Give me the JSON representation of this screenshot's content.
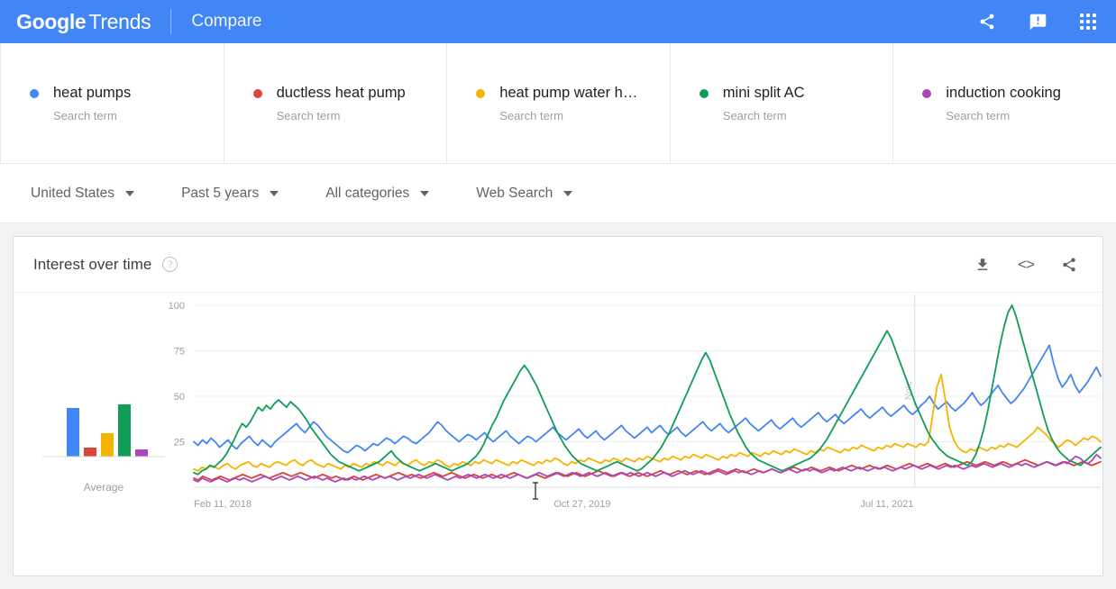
{
  "header": {
    "logo_google": "Google",
    "logo_trends": "Trends",
    "page_label": "Compare",
    "icons": {
      "share": "share-icon",
      "feedback": "feedback-icon",
      "apps": "apps-grid-icon"
    }
  },
  "terms": [
    {
      "label": "heat pumps",
      "subtitle": "Search term",
      "color": "#4285f4"
    },
    {
      "label": "ductless heat pump",
      "subtitle": "Search term",
      "color": "#db4437"
    },
    {
      "label": "heat pump water h…",
      "subtitle": "Search term",
      "color": "#f4b400"
    },
    {
      "label": "mini split AC",
      "subtitle": "Search term",
      "color": "#0f9d58"
    },
    {
      "label": "induction cooking",
      "subtitle": "Search term",
      "color": "#ab47bc"
    }
  ],
  "filters": [
    {
      "label": "United States"
    },
    {
      "label": "Past 5 years"
    },
    {
      "label": "All categories"
    },
    {
      "label": "Web Search"
    }
  ],
  "card": {
    "title": "Interest over time",
    "help": "?",
    "tools": {
      "download": "download-icon",
      "embed": "<>",
      "share": "share-icon"
    }
  },
  "chart_data": {
    "type": "line",
    "title": "Interest over time",
    "xlabel": "",
    "ylabel": "",
    "ylim": [
      0,
      100
    ],
    "yticks": [
      25,
      50,
      75,
      100
    ],
    "xticks": [
      "Feb 11, 2018",
      "Oct 27, 2019",
      "Jul 11, 2021"
    ],
    "xtick_positions": [
      0.0,
      0.397,
      0.735
    ],
    "grid": true,
    "legend": "top",
    "annotation": {
      "label": "Note",
      "x_fraction": 0.795
    },
    "average": {
      "label": "Average",
      "values": [
        27,
        5,
        13,
        29,
        4
      ]
    },
    "series": [
      {
        "name": "heat pumps",
        "color": "#4285f4",
        "values": [
          25,
          23,
          26,
          24,
          27,
          25,
          22,
          24,
          26,
          23,
          21,
          24,
          26,
          28,
          25,
          23,
          26,
          24,
          22,
          25,
          27,
          29,
          31,
          33,
          35,
          32,
          30,
          33,
          36,
          34,
          31,
          28,
          26,
          24,
          22,
          20,
          19,
          21,
          23,
          22,
          20,
          22,
          24,
          23,
          25,
          27,
          26,
          24,
          26,
          28,
          27,
          25,
          24,
          26,
          28,
          30,
          33,
          36,
          34,
          31,
          29,
          27,
          25,
          27,
          29,
          28,
          26,
          28,
          30,
          27,
          25,
          27,
          29,
          31,
          28,
          26,
          24,
          26,
          28,
          27,
          25,
          27,
          29,
          31,
          33,
          30,
          28,
          26,
          28,
          30,
          32,
          29,
          27,
          29,
          31,
          28,
          26,
          28,
          30,
          32,
          34,
          31,
          29,
          27,
          29,
          31,
          33,
          30,
          32,
          34,
          31,
          29,
          31,
          33,
          30,
          28,
          30,
          32,
          34,
          36,
          33,
          31,
          33,
          35,
          32,
          30,
          32,
          34,
          36,
          38,
          35,
          33,
          31,
          33,
          35,
          37,
          34,
          32,
          34,
          36,
          38,
          35,
          33,
          35,
          37,
          39,
          41,
          38,
          36,
          38,
          40,
          37,
          35,
          37,
          39,
          41,
          43,
          40,
          38,
          40,
          42,
          44,
          41,
          39,
          41,
          43,
          45,
          42,
          40,
          42,
          45,
          47,
          50,
          46,
          43,
          45,
          47,
          44,
          42,
          44,
          46,
          49,
          52,
          48,
          45,
          47,
          50,
          53,
          56,
          52,
          49,
          46,
          48,
          51,
          54,
          58,
          62,
          66,
          70,
          74,
          78,
          68,
          60,
          55,
          58,
          62,
          56,
          52,
          55,
          58,
          62,
          66,
          61
        ]
      },
      {
        "name": "ductless heat pump",
        "color": "#db4437",
        "values": [
          5,
          4,
          6,
          5,
          4,
          5,
          6,
          5,
          4,
          5,
          6,
          7,
          6,
          5,
          6,
          7,
          6,
          5,
          6,
          7,
          8,
          7,
          6,
          7,
          8,
          7,
          6,
          5,
          6,
          7,
          6,
          5,
          6,
          5,
          4,
          5,
          6,
          5,
          4,
          5,
          6,
          7,
          6,
          5,
          6,
          7,
          8,
          7,
          6,
          7,
          6,
          5,
          6,
          7,
          8,
          7,
          6,
          7,
          8,
          7,
          6,
          5,
          6,
          7,
          6,
          5,
          6,
          7,
          6,
          5,
          6,
          7,
          8,
          7,
          6,
          5,
          6,
          7,
          6,
          5,
          6,
          7,
          8,
          7,
          6,
          7,
          8,
          7,
          6,
          7,
          8,
          9,
          8,
          7,
          6,
          7,
          8,
          7,
          6,
          7,
          8,
          7,
          6,
          7,
          8,
          9,
          8,
          7,
          8,
          9,
          8,
          7,
          8,
          9,
          8,
          7,
          8,
          9,
          10,
          9,
          8,
          9,
          10,
          9,
          8,
          9,
          10,
          9,
          8,
          9,
          10,
          9,
          8,
          9,
          10,
          11,
          10,
          9,
          10,
          11,
          10,
          9,
          10,
          11,
          10,
          9,
          10,
          11,
          12,
          11,
          10,
          11,
          12,
          11,
          10,
          11,
          12,
          11,
          10,
          11,
          12,
          13,
          12,
          11,
          12,
          13,
          12,
          11,
          12,
          13,
          12,
          11,
          12,
          13,
          14,
          13,
          12,
          13,
          14,
          13,
          12,
          13,
          14,
          13,
          12,
          13,
          14,
          15,
          14,
          13,
          12,
          13,
          14,
          13,
          12,
          13,
          14,
          13,
          12,
          13,
          14,
          13,
          12,
          13,
          14
        ]
      },
      {
        "name": "heat pump water h…",
        "color": "#f4b400",
        "values": [
          10,
          9,
          11,
          10,
          12,
          11,
          10,
          12,
          13,
          11,
          10,
          12,
          13,
          14,
          12,
          11,
          13,
          12,
          11,
          13,
          14,
          13,
          12,
          14,
          15,
          13,
          12,
          14,
          15,
          13,
          12,
          11,
          13,
          12,
          11,
          10,
          12,
          11,
          13,
          12,
          11,
          13,
          12,
          14,
          13,
          12,
          14,
          13,
          12,
          14,
          13,
          12,
          14,
          15,
          13,
          12,
          14,
          13,
          15,
          14,
          12,
          11,
          13,
          12,
          14,
          13,
          12,
          14,
          13,
          15,
          14,
          13,
          15,
          14,
          13,
          12,
          14,
          13,
          15,
          14,
          13,
          12,
          14,
          13,
          15,
          14,
          16,
          15,
          13,
          12,
          14,
          13,
          15,
          14,
          16,
          15,
          14,
          13,
          15,
          14,
          16,
          15,
          14,
          16,
          15,
          14,
          16,
          15,
          17,
          16,
          15,
          14,
          16,
          15,
          17,
          16,
          15,
          17,
          16,
          18,
          17,
          16,
          18,
          17,
          16,
          15,
          17,
          16,
          18,
          17,
          19,
          18,
          17,
          19,
          18,
          17,
          19,
          18,
          20,
          19,
          18,
          20,
          19,
          21,
          20,
          19,
          18,
          20,
          19,
          21,
          20,
          22,
          21,
          20,
          19,
          21,
          20,
          22,
          21,
          23,
          22,
          21,
          20,
          22,
          21,
          23,
          22,
          24,
          23,
          22,
          24,
          23,
          22,
          24,
          23,
          25,
          40,
          55,
          62,
          48,
          33,
          26,
          22,
          20,
          19,
          21,
          20,
          22,
          21,
          20,
          22,
          21,
          23,
          22,
          24,
          23,
          22,
          24,
          26,
          28,
          30,
          33,
          31,
          29,
          26,
          24,
          22,
          24,
          26,
          25,
          23,
          25,
          27,
          26,
          28,
          27,
          25
        ]
      },
      {
        "name": "mini split AC",
        "color": "#0f9d58",
        "values": [
          8,
          7,
          9,
          10,
          12,
          11,
          13,
          15,
          18,
          22,
          26,
          31,
          35,
          33,
          36,
          40,
          44,
          42,
          45,
          43,
          46,
          48,
          46,
          44,
          47,
          45,
          43,
          40,
          37,
          33,
          30,
          27,
          24,
          21,
          18,
          16,
          14,
          13,
          12,
          11,
          10,
          9,
          10,
          11,
          12,
          13,
          14,
          16,
          18,
          20,
          17,
          15,
          13,
          12,
          11,
          10,
          9,
          10,
          11,
          12,
          13,
          12,
          11,
          10,
          9,
          10,
          11,
          12,
          13,
          15,
          17,
          20,
          24,
          29,
          34,
          38,
          43,
          48,
          52,
          56,
          60,
          64,
          67,
          64,
          60,
          56,
          51,
          46,
          41,
          36,
          31,
          27,
          23,
          20,
          17,
          15,
          13,
          12,
          11,
          10,
          9,
          10,
          11,
          12,
          13,
          14,
          13,
          12,
          11,
          10,
          9,
          10,
          12,
          14,
          16,
          19,
          22,
          26,
          30,
          35,
          40,
          45,
          50,
          55,
          60,
          65,
          70,
          74,
          70,
          64,
          58,
          52,
          46,
          40,
          35,
          30,
          26,
          22,
          19,
          17,
          15,
          14,
          13,
          12,
          11,
          10,
          9,
          10,
          11,
          12,
          13,
          14,
          15,
          16,
          18,
          20,
          23,
          26,
          30,
          34,
          38,
          42,
          46,
          50,
          54,
          58,
          62,
          66,
          70,
          74,
          78,
          82,
          86,
          82,
          76,
          70,
          64,
          58,
          52,
          46,
          41,
          36,
          31,
          27,
          24,
          21,
          19,
          17,
          16,
          15,
          14,
          13,
          12,
          14,
          18,
          24,
          32,
          42,
          54,
          66,
          78,
          88,
          96,
          100,
          94,
          86,
          78,
          70,
          62,
          54,
          46,
          38,
          31,
          26,
          22,
          19,
          17,
          15,
          14,
          13,
          12,
          14,
          16,
          18,
          20,
          22
        ]
      },
      {
        "name": "induction cooking",
        "color": "#ab47bc",
        "values": [
          4,
          3,
          5,
          4,
          3,
          4,
          5,
          4,
          3,
          4,
          5,
          4,
          5,
          4,
          3,
          4,
          5,
          6,
          5,
          4,
          5,
          6,
          5,
          4,
          5,
          6,
          5,
          4,
          5,
          6,
          5,
          4,
          5,
          4,
          3,
          4,
          5,
          4,
          5,
          4,
          5,
          6,
          5,
          4,
          5,
          6,
          5,
          6,
          5,
          4,
          5,
          6,
          5,
          6,
          7,
          6,
          5,
          6,
          7,
          6,
          5,
          4,
          5,
          6,
          5,
          6,
          7,
          6,
          5,
          6,
          7,
          6,
          5,
          6,
          7,
          6,
          5,
          6,
          7,
          6,
          5,
          6,
          7,
          8,
          7,
          6,
          7,
          8,
          7,
          6,
          7,
          8,
          7,
          6,
          7,
          8,
          7,
          6,
          7,
          8,
          7,
          6,
          7,
          8,
          7,
          8,
          7,
          6,
          7,
          8,
          7,
          6,
          7,
          8,
          7,
          6,
          7,
          8,
          9,
          8,
          7,
          8,
          9,
          8,
          7,
          8,
          9,
          8,
          7,
          8,
          9,
          8,
          9,
          8,
          7,
          8,
          9,
          8,
          9,
          10,
          9,
          8,
          9,
          10,
          9,
          8,
          9,
          10,
          9,
          10,
          9,
          8,
          9,
          10,
          9,
          10,
          11,
          10,
          9,
          10,
          11,
          10,
          9,
          10,
          11,
          10,
          11,
          10,
          9,
          10,
          11,
          10,
          11,
          12,
          11,
          10,
          11,
          12,
          11,
          10,
          11,
          12,
          11,
          12,
          11,
          10,
          11,
          12,
          11,
          12,
          13,
          12,
          11,
          12,
          13,
          12,
          11,
          12,
          13,
          12,
          13,
          12,
          11,
          12,
          13,
          14,
          13,
          12,
          13,
          14,
          13,
          15,
          17,
          16,
          14,
          13,
          15,
          18,
          16
        ]
      }
    ]
  }
}
